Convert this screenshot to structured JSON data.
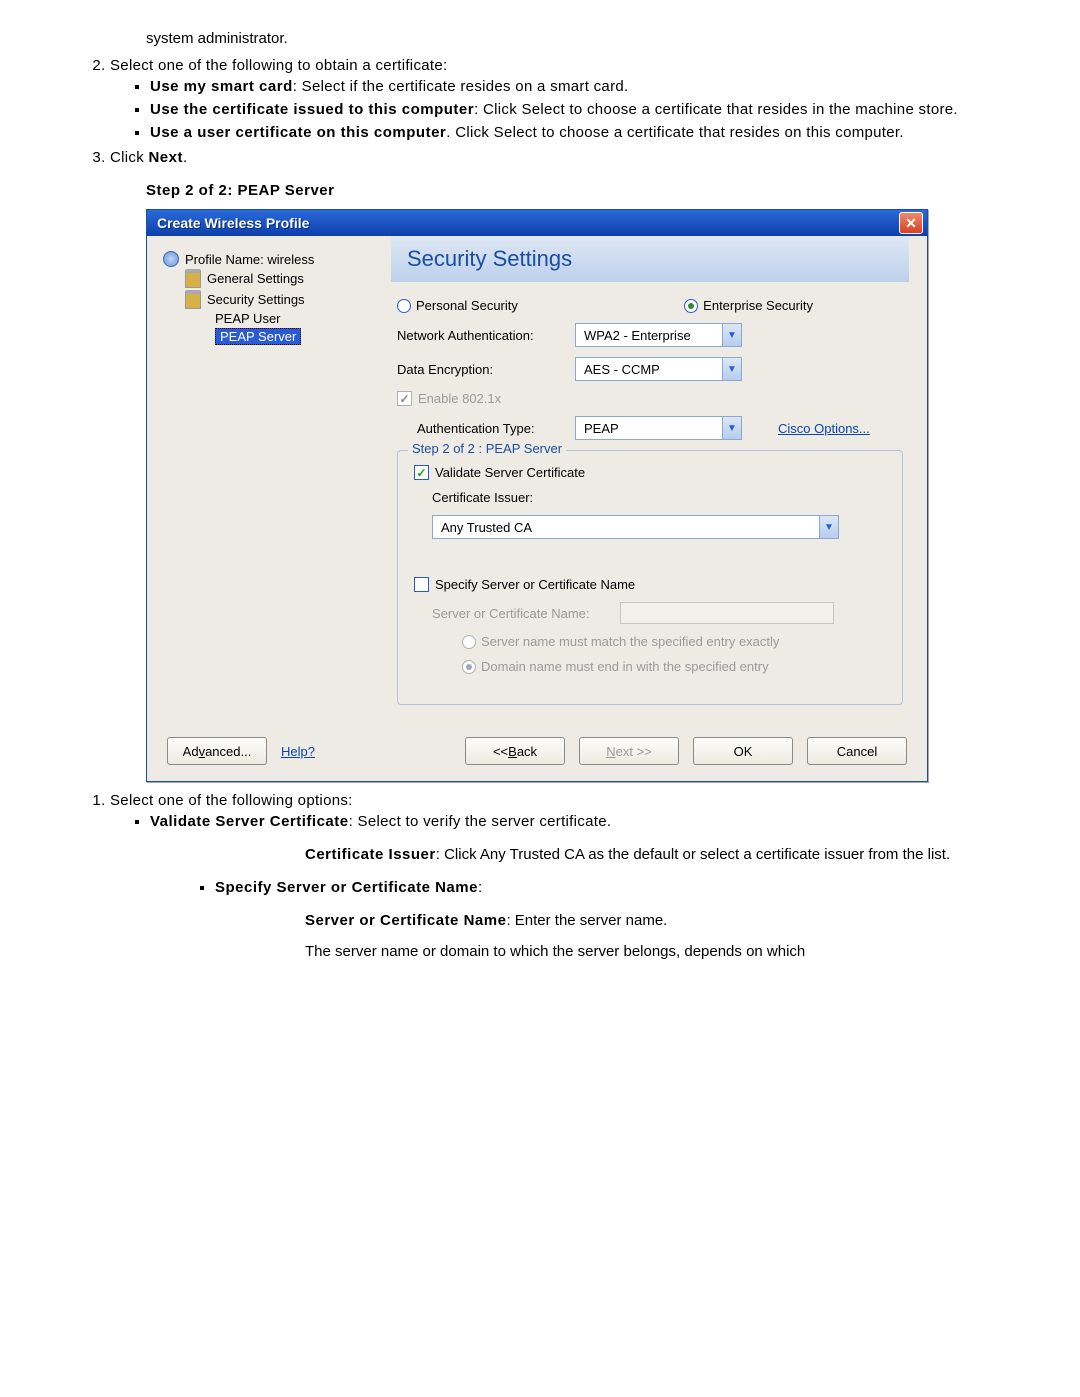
{
  "doc": {
    "p_sysadmin": "system administrator.",
    "li2": "Select one of the following to obtain a certificate:",
    "b_smart_label": "Use my smart card",
    "b_smart_rest": ": Select if the certificate resides on a smart card.",
    "b_issued_label": "Use the certificate issued to this computer",
    "b_issued_rest": ": Click Select to choose a certificate that resides in the machine store.",
    "b_user_label": "Use a user certificate on this computer",
    "b_user_rest": ". Click Select to choose a certificate that resides on this computer.",
    "li3_pre": "Click ",
    "li3_b": "Next",
    "li3_post": ".",
    "step_heading": "Step 2 of 2: PEAP Server",
    "post_li1": "Select one of the following options:",
    "post_b1_label": "Validate Server Certificate",
    "post_b1_rest": ": Select to verify the server certificate.",
    "post_p1a": "Certificate Issuer",
    "post_p1b": ": Click Any Trusted CA as the default or select a certificate issuer from the list.",
    "post_b2_label": "Specify Server or Certificate Name",
    "post_b2_rest": ":",
    "post_p2a": "Server or Certificate Name",
    "post_p2b": ": Enter the server name.",
    "post_p3": "The server name or domain to which the server belongs, depends on which"
  },
  "dialog": {
    "title": "Create Wireless Profile",
    "tree": {
      "profile": "Profile Name: wireless",
      "general": "General Settings",
      "security": "Security Settings",
      "peap_user": "PEAP User",
      "peap_server": "PEAP Server"
    },
    "banner": "Security Settings",
    "radio_personal": "Personal Security",
    "radio_enterprise": "Enterprise Security",
    "lbl_netauth": "Network Authentication:",
    "val_netauth": "WPA2 - Enterprise",
    "lbl_dataenc": "Data Encryption:",
    "val_dataenc": "AES - CCMP",
    "chk_8021x": "Enable 802.1x",
    "lbl_authtype": "Authentication Type:",
    "val_authtype": "PEAP",
    "link_cisco_pre": "C",
    "link_cisco_rest": "isco Options...",
    "group_legend": "Step 2 of 2 : PEAP Server",
    "chk_validate": "Validate Server Certificate",
    "lbl_certissuer": "Certificate Issuer:",
    "val_certissuer": "Any Trusted CA",
    "chk_specify": "Specify Server or Certificate Name",
    "lbl_servname": "Server or Certificate Name:",
    "radio_exact": "Server name must match the specified entry exactly",
    "radio_domain": "Domain name must end in with the specified entry",
    "footer": {
      "advanced_pre": "Ad",
      "advanced_u": "v",
      "advanced_post": "anced...",
      "help": "Help?",
      "back_pre": "<< ",
      "back_u": "B",
      "back_post": "ack",
      "next_u": "N",
      "next_post": "ext >>",
      "ok": "OK",
      "cancel": "Cancel"
    }
  }
}
